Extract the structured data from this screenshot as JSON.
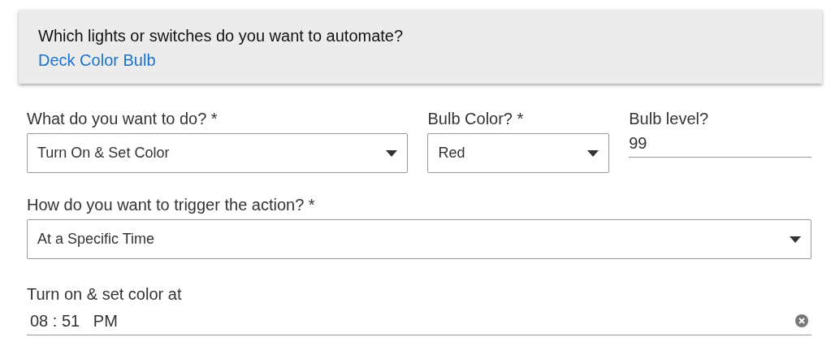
{
  "device_card": {
    "question": "Which lights or switches do you want to automate?",
    "device_link": "Deck Color Bulb"
  },
  "fields": [
    {
      "kind": "select",
      "label": "What do you want to do? *",
      "value": "Turn On & Set Color"
    },
    {
      "kind": "select",
      "label": "Bulb Color? *",
      "value": "Red"
    },
    {
      "kind": "text",
      "label": "Bulb level?",
      "value": "99"
    }
  ],
  "trigger": {
    "label": "How do you want to trigger the action? *",
    "value": "At a Specific Time"
  },
  "time": {
    "label": "Turn on & set color at",
    "hour": "08",
    "separator": ":",
    "minute": "51",
    "period": "PM"
  }
}
